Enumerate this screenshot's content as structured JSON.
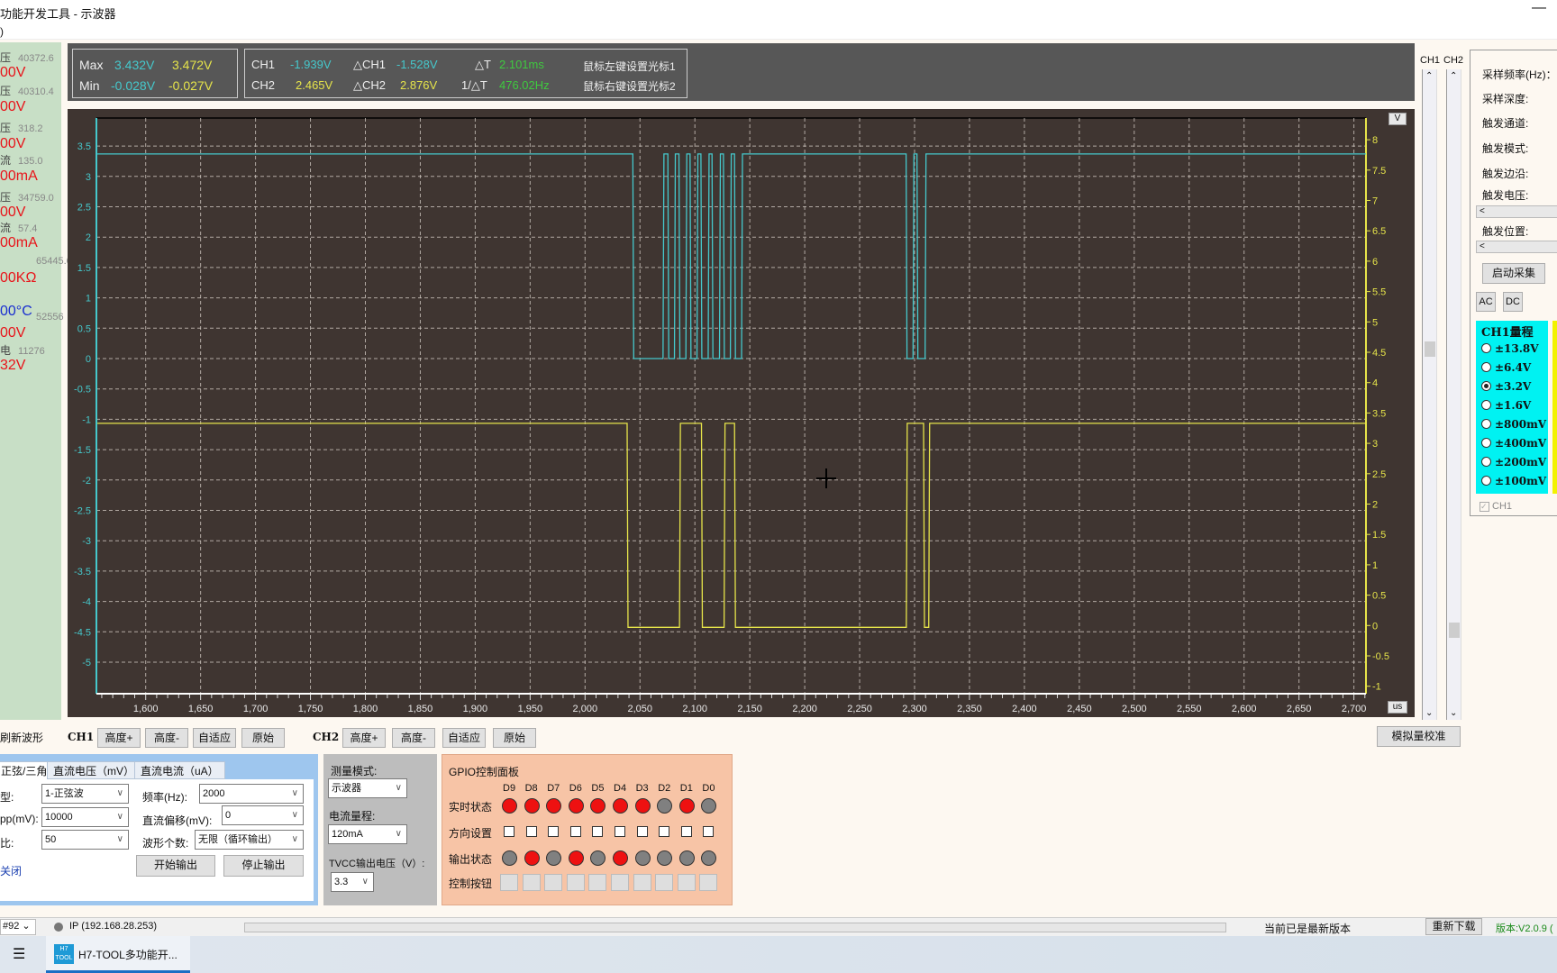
{
  "window": {
    "title": "功能开发工具 - 示波器",
    "menu_fragment": ")"
  },
  "left_panel": {
    "items": [
      {
        "label": "压",
        "raw": "40372.6",
        "value": "00V",
        "color": "#e8141a"
      },
      {
        "label": "压",
        "raw": "40310.4",
        "value": "00V",
        "color": "#e8141a"
      },
      {
        "label": "压",
        "raw": "318.2",
        "value": "00V",
        "color": "#e8141a"
      },
      {
        "label": "流",
        "raw": "135.0",
        "value": "00mA",
        "color": "#e8141a"
      },
      {
        "label": "压",
        "raw": "34759.0",
        "value": "00V",
        "color": "#e8141a"
      },
      {
        "label": "流",
        "raw": "57.4",
        "value": "00mA",
        "color": "#e8141a"
      },
      {
        "label": "",
        "raw": "65445.6",
        "value": "00KΩ",
        "color": "#e8141a"
      },
      {
        "label": "",
        "raw": "",
        "value": "00°C",
        "color": "#1a2fd0"
      },
      {
        "label": "",
        "raw": "52556",
        "value": "00V",
        "color": "#e8141a"
      },
      {
        "label": "电",
        "raw": "11276",
        "value": "32V",
        "color": "#e8141a"
      }
    ]
  },
  "measure": {
    "max_label": "Max",
    "min_label": "Min",
    "ch1_max": "3.432V",
    "ch2_max": "3.472V",
    "ch1_min": "-0.028V",
    "ch2_min": "-0.027V",
    "ch1_label": "CH1",
    "ch1_cursor": "-1.939V",
    "dch1_label": "△CH1",
    "dch1": "-1.528V",
    "ch2_label": "CH2",
    "ch2_cursor": "2.465V",
    "dch2_label": "△CH2",
    "dch2": "2.876V",
    "dt_label": "△T",
    "dt": "2.101ms",
    "inv_dt_label": "1/△T",
    "inv_dt": "476.02Hz",
    "hint1": "鼠标左键设置光标1",
    "hint2": "鼠标右键设置光标2"
  },
  "plot": {
    "y_unit_button": "V",
    "x_unit_button": "us",
    "cursor_icon": "crosshair"
  },
  "chart_data": {
    "type": "line",
    "x_unit": "us",
    "xlim": [
      1556,
      2713
    ],
    "x_ticks": [
      1600,
      1650,
      1700,
      1750,
      1800,
      1850,
      1900,
      1950,
      2000,
      2050,
      2100,
      2150,
      2200,
      2250,
      2300,
      2350,
      2400,
      2450,
      2500,
      2550,
      2600,
      2650,
      2700
    ],
    "x_tick_labels": [
      "1,600",
      "1,650",
      "1,700",
      "1,750",
      "1,800",
      "1,850",
      "1,900",
      "1,950",
      "2,000",
      "2,050",
      "2,100",
      "2,150",
      "2,200",
      "2,250",
      "2,300",
      "2,350",
      "2,400",
      "2,450",
      "2,500",
      "2,550",
      "2,600",
      "2,650",
      "2,700"
    ],
    "left_axis": {
      "ylim": [
        -5.54,
        3.95
      ],
      "ticks": [
        3.5,
        3,
        2.5,
        2,
        1.5,
        1,
        0.5,
        0,
        -0.5,
        -1,
        -1.5,
        -2,
        -2.5,
        -3,
        -3.5,
        -4,
        -4.5,
        -5
      ],
      "color": "#45c8cc"
    },
    "right_axis": {
      "ylim": [
        -1.12,
        8.2
      ],
      "ticks": [
        8,
        7.5,
        7,
        6.5,
        6,
        5.5,
        5,
        4.5,
        4,
        3.5,
        3,
        2.5,
        2,
        1.5,
        1,
        0.5,
        0,
        -0.5,
        -1
      ],
      "color": "#e6e44a"
    },
    "grid": true,
    "series": [
      {
        "name": "CH1",
        "axis": "left",
        "color": "#45c8cc",
        "high": 3.37,
        "low": 0.0,
        "start": "high",
        "edges": [
          2043.5,
          2071.0,
          2075.4,
          2081.4,
          2085.5,
          2091.8,
          2095.6,
          2101.9,
          2105.5,
          2112.1,
          2115.6,
          2122.4,
          2126.0,
          2132.3,
          2136.1,
          2142.5,
          2292.3,
          2298.6,
          2302.2,
          2309.6
        ]
      },
      {
        "name": "CH2",
        "axis": "right",
        "color": "#e6e44a",
        "high": 3.33,
        "low": -0.03,
        "start": "high",
        "edges": [
          2038.3,
          2086.0,
          2106.0,
          2126.6,
          2136.1,
          2292.5,
          2308.2,
          2312.9
        ]
      }
    ]
  },
  "scrollbars": {
    "ch1_label": "CH1",
    "ch2_label": "CH2"
  },
  "right_panel": {
    "sample_rate": "采样频率(Hz)：",
    "sample_depth": "采样深度:",
    "trigger_channel": "触发通道:",
    "trigger_mode": "触发模式:",
    "trigger_edge": "触发边沿:",
    "trigger_voltage": "触发电压:",
    "trigger_position": "触发位置:",
    "start_button": "启动采集",
    "ac": "AC",
    "dc": "DC",
    "range_title": "CH1量程",
    "ranges": [
      "±13.8V",
      "±6.4V",
      "±3.2V",
      "±1.6V",
      "±800mV",
      "±400mV",
      "±200mV",
      "±100mV"
    ],
    "selected_range": "±3.2V",
    "ch1_checkbox": "CH1"
  },
  "controls": {
    "refresh": "刷新波形",
    "ch1": "CH1",
    "ch2": "CH2",
    "height_plus": "高度+",
    "height_minus": "高度-",
    "auto": "自适应",
    "original": "原始",
    "calibrate": "模拟量校准"
  },
  "generator": {
    "tabs": [
      "正弦/三角",
      "直流电压（mV）",
      "直流电流（uA）"
    ],
    "type_label": "型:",
    "type_value": "1-正弦波",
    "freq_label": "频率(Hz):",
    "freq_value": "2000",
    "vpp_label": "pp(mV):",
    "vpp_value": "10000",
    "offset_label": "直流偏移(mV):",
    "offset_value": "0",
    "duty_label": "比:",
    "duty_value": "50",
    "count_label": "波形个数:",
    "count_value": "无限（循环输出）",
    "close_link": "关闭",
    "start": "开始输出",
    "stop": "停止输出"
  },
  "measure_mode": {
    "mode_label": "测量模式:",
    "mode_value": "示波器",
    "current_label": "电流量程:",
    "current_value": "120mA",
    "tvcc_label": "TVCC输出电压（V）:",
    "tvcc_value": "3.3"
  },
  "gpio": {
    "title": "GPIO控制面板",
    "pins": [
      "D9",
      "D8",
      "D7",
      "D6",
      "D5",
      "D4",
      "D3",
      "D2",
      "D1",
      "D0"
    ],
    "realtime_label": "实时状态",
    "direction_label": "方向设置",
    "output_label": "输出状态",
    "button_label": "控制按钮",
    "realtime": [
      1,
      1,
      1,
      1,
      1,
      1,
      1,
      0,
      1,
      0
    ],
    "output": [
      0,
      1,
      0,
      1,
      0,
      1,
      0,
      0,
      0,
      0
    ],
    "on_color": "#ee1111",
    "off_color": "#808080"
  },
  "status": {
    "port": "#92",
    "ip": "IP (192.168.28.253)",
    "update_text": "当前已是最新版本",
    "redownload": "重新下载",
    "version": "版本:V2.0.9 ("
  },
  "taskbar": {
    "app_label": "H7-TOOL多功能开...",
    "app_icon_text": "H7 TOOL"
  }
}
